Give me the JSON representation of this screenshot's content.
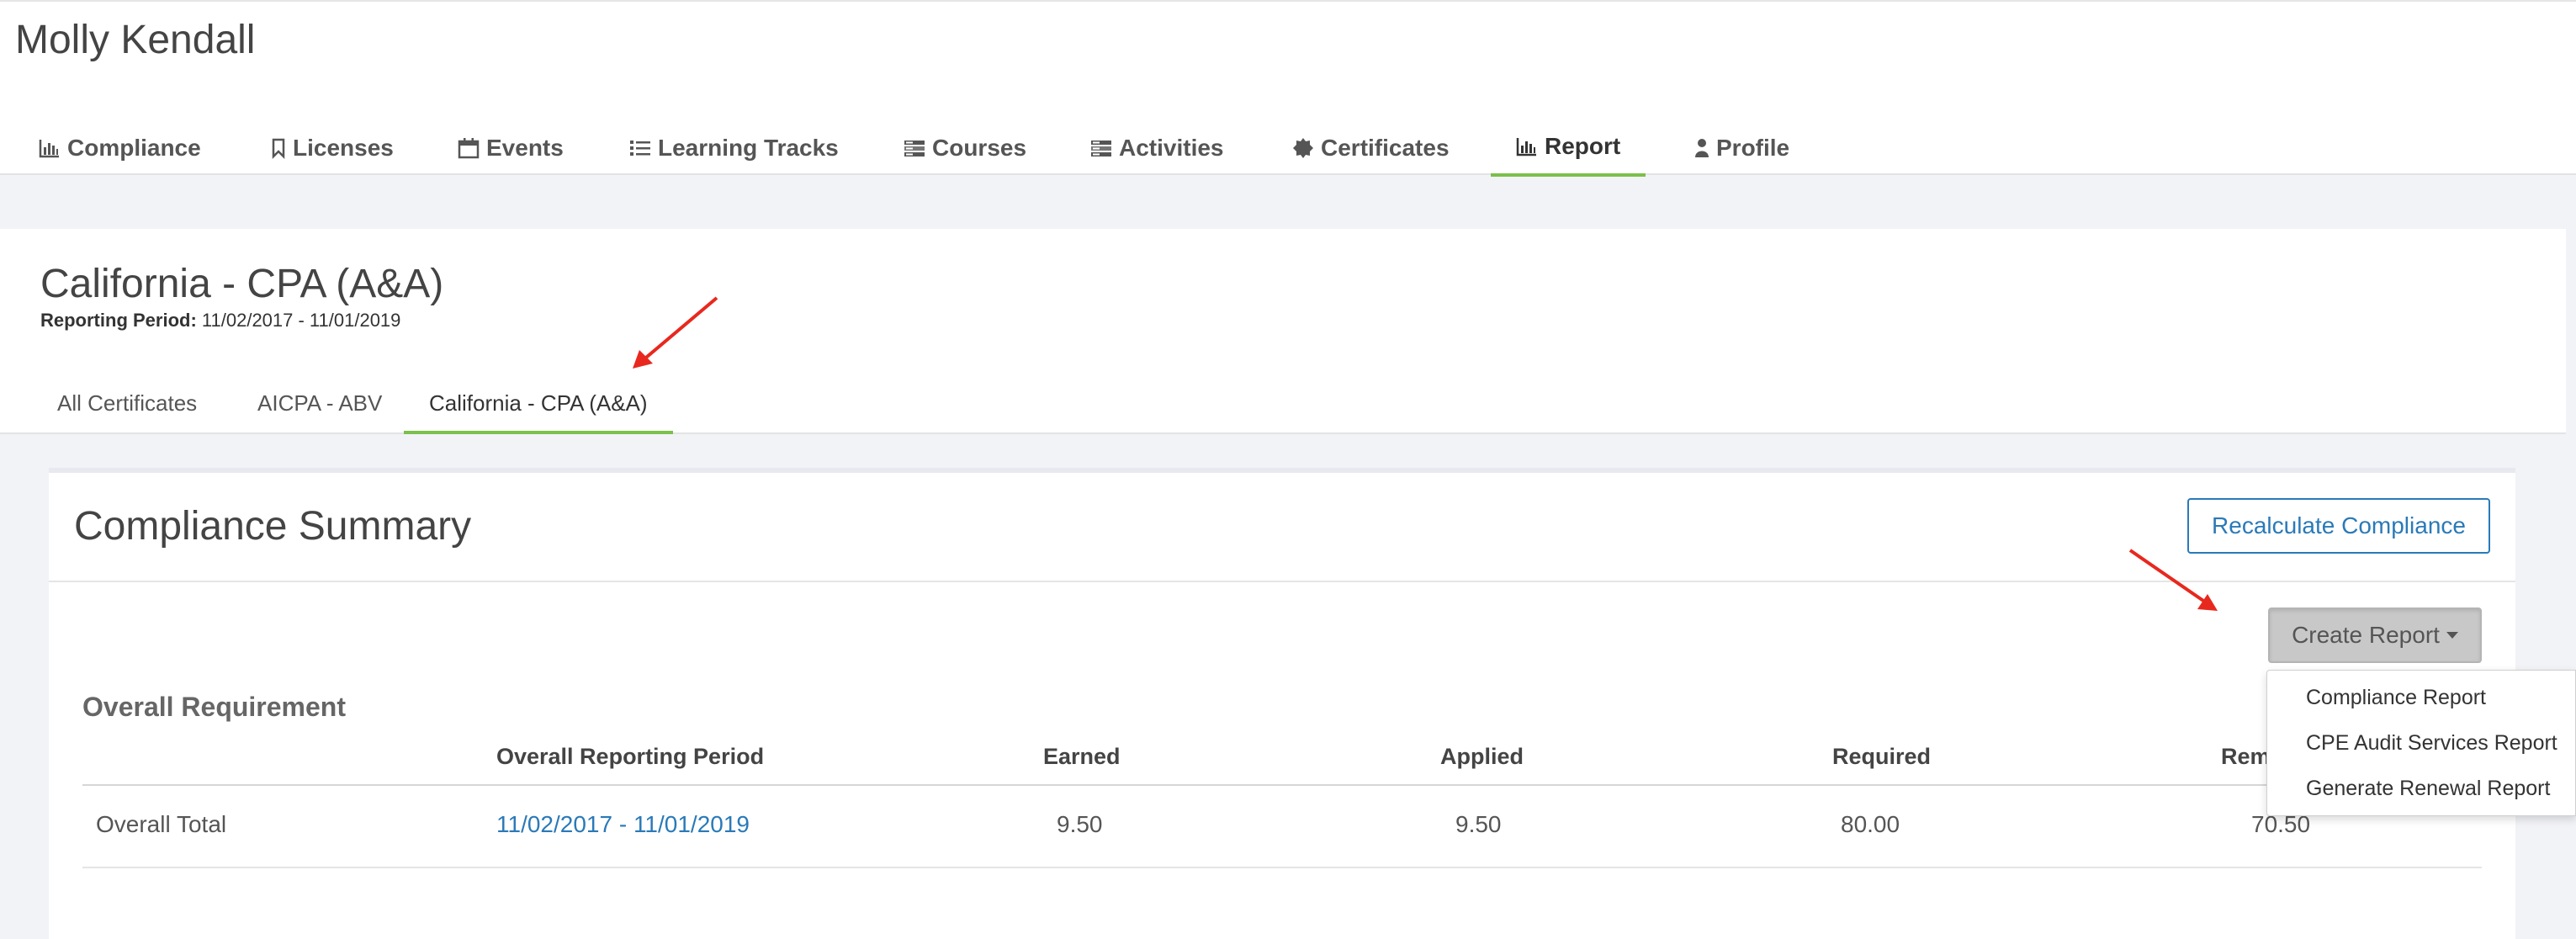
{
  "user": {
    "name": "Molly Kendall"
  },
  "nav": {
    "items": [
      {
        "label": "Compliance",
        "icon": "bar-chart-icon"
      },
      {
        "label": "Licenses",
        "icon": "bookmark-icon"
      },
      {
        "label": "Events",
        "icon": "calendar-icon"
      },
      {
        "label": "Learning Tracks",
        "icon": "list-icon"
      },
      {
        "label": "Courses",
        "icon": "stack-icon"
      },
      {
        "label": "Activities",
        "icon": "stack-icon"
      },
      {
        "label": "Certificates",
        "icon": "certificate-icon"
      },
      {
        "label": "Report",
        "icon": "bar-chart-icon"
      },
      {
        "label": "Profile",
        "icon": "user-icon"
      }
    ],
    "active": "Report"
  },
  "certificate": {
    "title": "California - CPA (A&A)",
    "period_label": "Reporting Period:",
    "period_value": "11/02/2017 - 11/01/2019",
    "tabs": [
      "All Certificates",
      "AICPA - ABV",
      "California - CPA (A&A)"
    ],
    "active_tab": "California - CPA (A&A)"
  },
  "summary": {
    "title": "Compliance Summary",
    "recalculate_label": "Recalculate Compliance",
    "create_report_label": "Create Report",
    "requirement_title": "Overall Requirement",
    "columns": [
      "",
      "Overall Reporting Period",
      "Earned",
      "Applied",
      "Required",
      "Remaining"
    ],
    "rows": [
      {
        "name": "Overall Total",
        "period": "11/02/2017 - 11/01/2019",
        "earned": "9.50",
        "applied": "9.50",
        "required": "80.00",
        "remaining": "70.50"
      }
    ]
  },
  "dropdown": {
    "items": [
      "Compliance Report",
      "CPE Audit Services Report",
      "Generate Renewal Report"
    ]
  },
  "colors": {
    "accent_green": "#7bc04a",
    "link_blue": "#2a7ab8",
    "arrow_red": "#e8281e"
  }
}
